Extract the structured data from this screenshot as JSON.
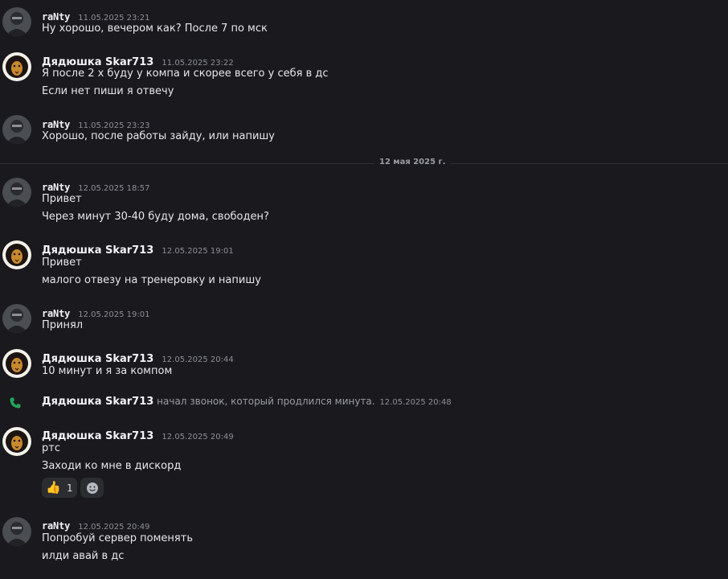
{
  "divider": {
    "label": "12 мая 2025 г."
  },
  "messages": [
    {
      "author": "raNty",
      "timestamp": "11.05.2025 23:21",
      "lines": [
        "Ну хорошо, вечером как? После 7 по мск"
      ]
    },
    {
      "author": "Дядюшка Skar713",
      "timestamp": "11.05.2025 23:22",
      "lines": [
        "Я после 2 х буду у компа и скорее всего у себя в дс",
        "Если нет пиши я отвечу"
      ]
    },
    {
      "author": "raNty",
      "timestamp": "11.05.2025 23:23",
      "lines": [
        "Хорошо, после работы зайду, или напишу"
      ]
    },
    {
      "author": "raNty",
      "timestamp": "12.05.2025 18:57",
      "lines": [
        "Привет",
        "Через минут 30-40 буду дома, свободен?"
      ]
    },
    {
      "author": "Дядюшка Skar713",
      "timestamp": "12.05.2025 19:01",
      "lines": [
        "Привет",
        "малого отвезу на тренеровку и напишу"
      ]
    },
    {
      "author": "raNty",
      "timestamp": "12.05.2025 19:01",
      "lines": [
        "Принял"
      ]
    },
    {
      "author": "Дядюшка Skar713",
      "timestamp": "12.05.2025 20:44",
      "lines": [
        "10 минут и я за компом"
      ]
    },
    {
      "author": "Дядюшка Skar713",
      "timestamp": "12.05.2025 20:49",
      "lines": [
        "ртс",
        "Заходи ко мне в дискорд"
      ]
    },
    {
      "author": "raNty",
      "timestamp": "12.05.2025 20:49",
      "lines": [
        "Попробуй сервер поменять",
        "илди авай в дс"
      ]
    }
  ],
  "call": {
    "author": "Дядюшка Skar713",
    "text": "начал звонок, который продлился минута.",
    "timestamp": "12.05.2025 20:48",
    "icon": "phone-icon",
    "color": "#23a55a"
  },
  "reactions": [
    {
      "emoji": "👍",
      "count": "1",
      "icon": "thumbs-up-icon"
    },
    {
      "icon": "add-reaction-icon"
    }
  ],
  "colors": {
    "background": "#1a1a1e",
    "author": "#f2f3f5",
    "timestamp": "#8c8f96"
  }
}
